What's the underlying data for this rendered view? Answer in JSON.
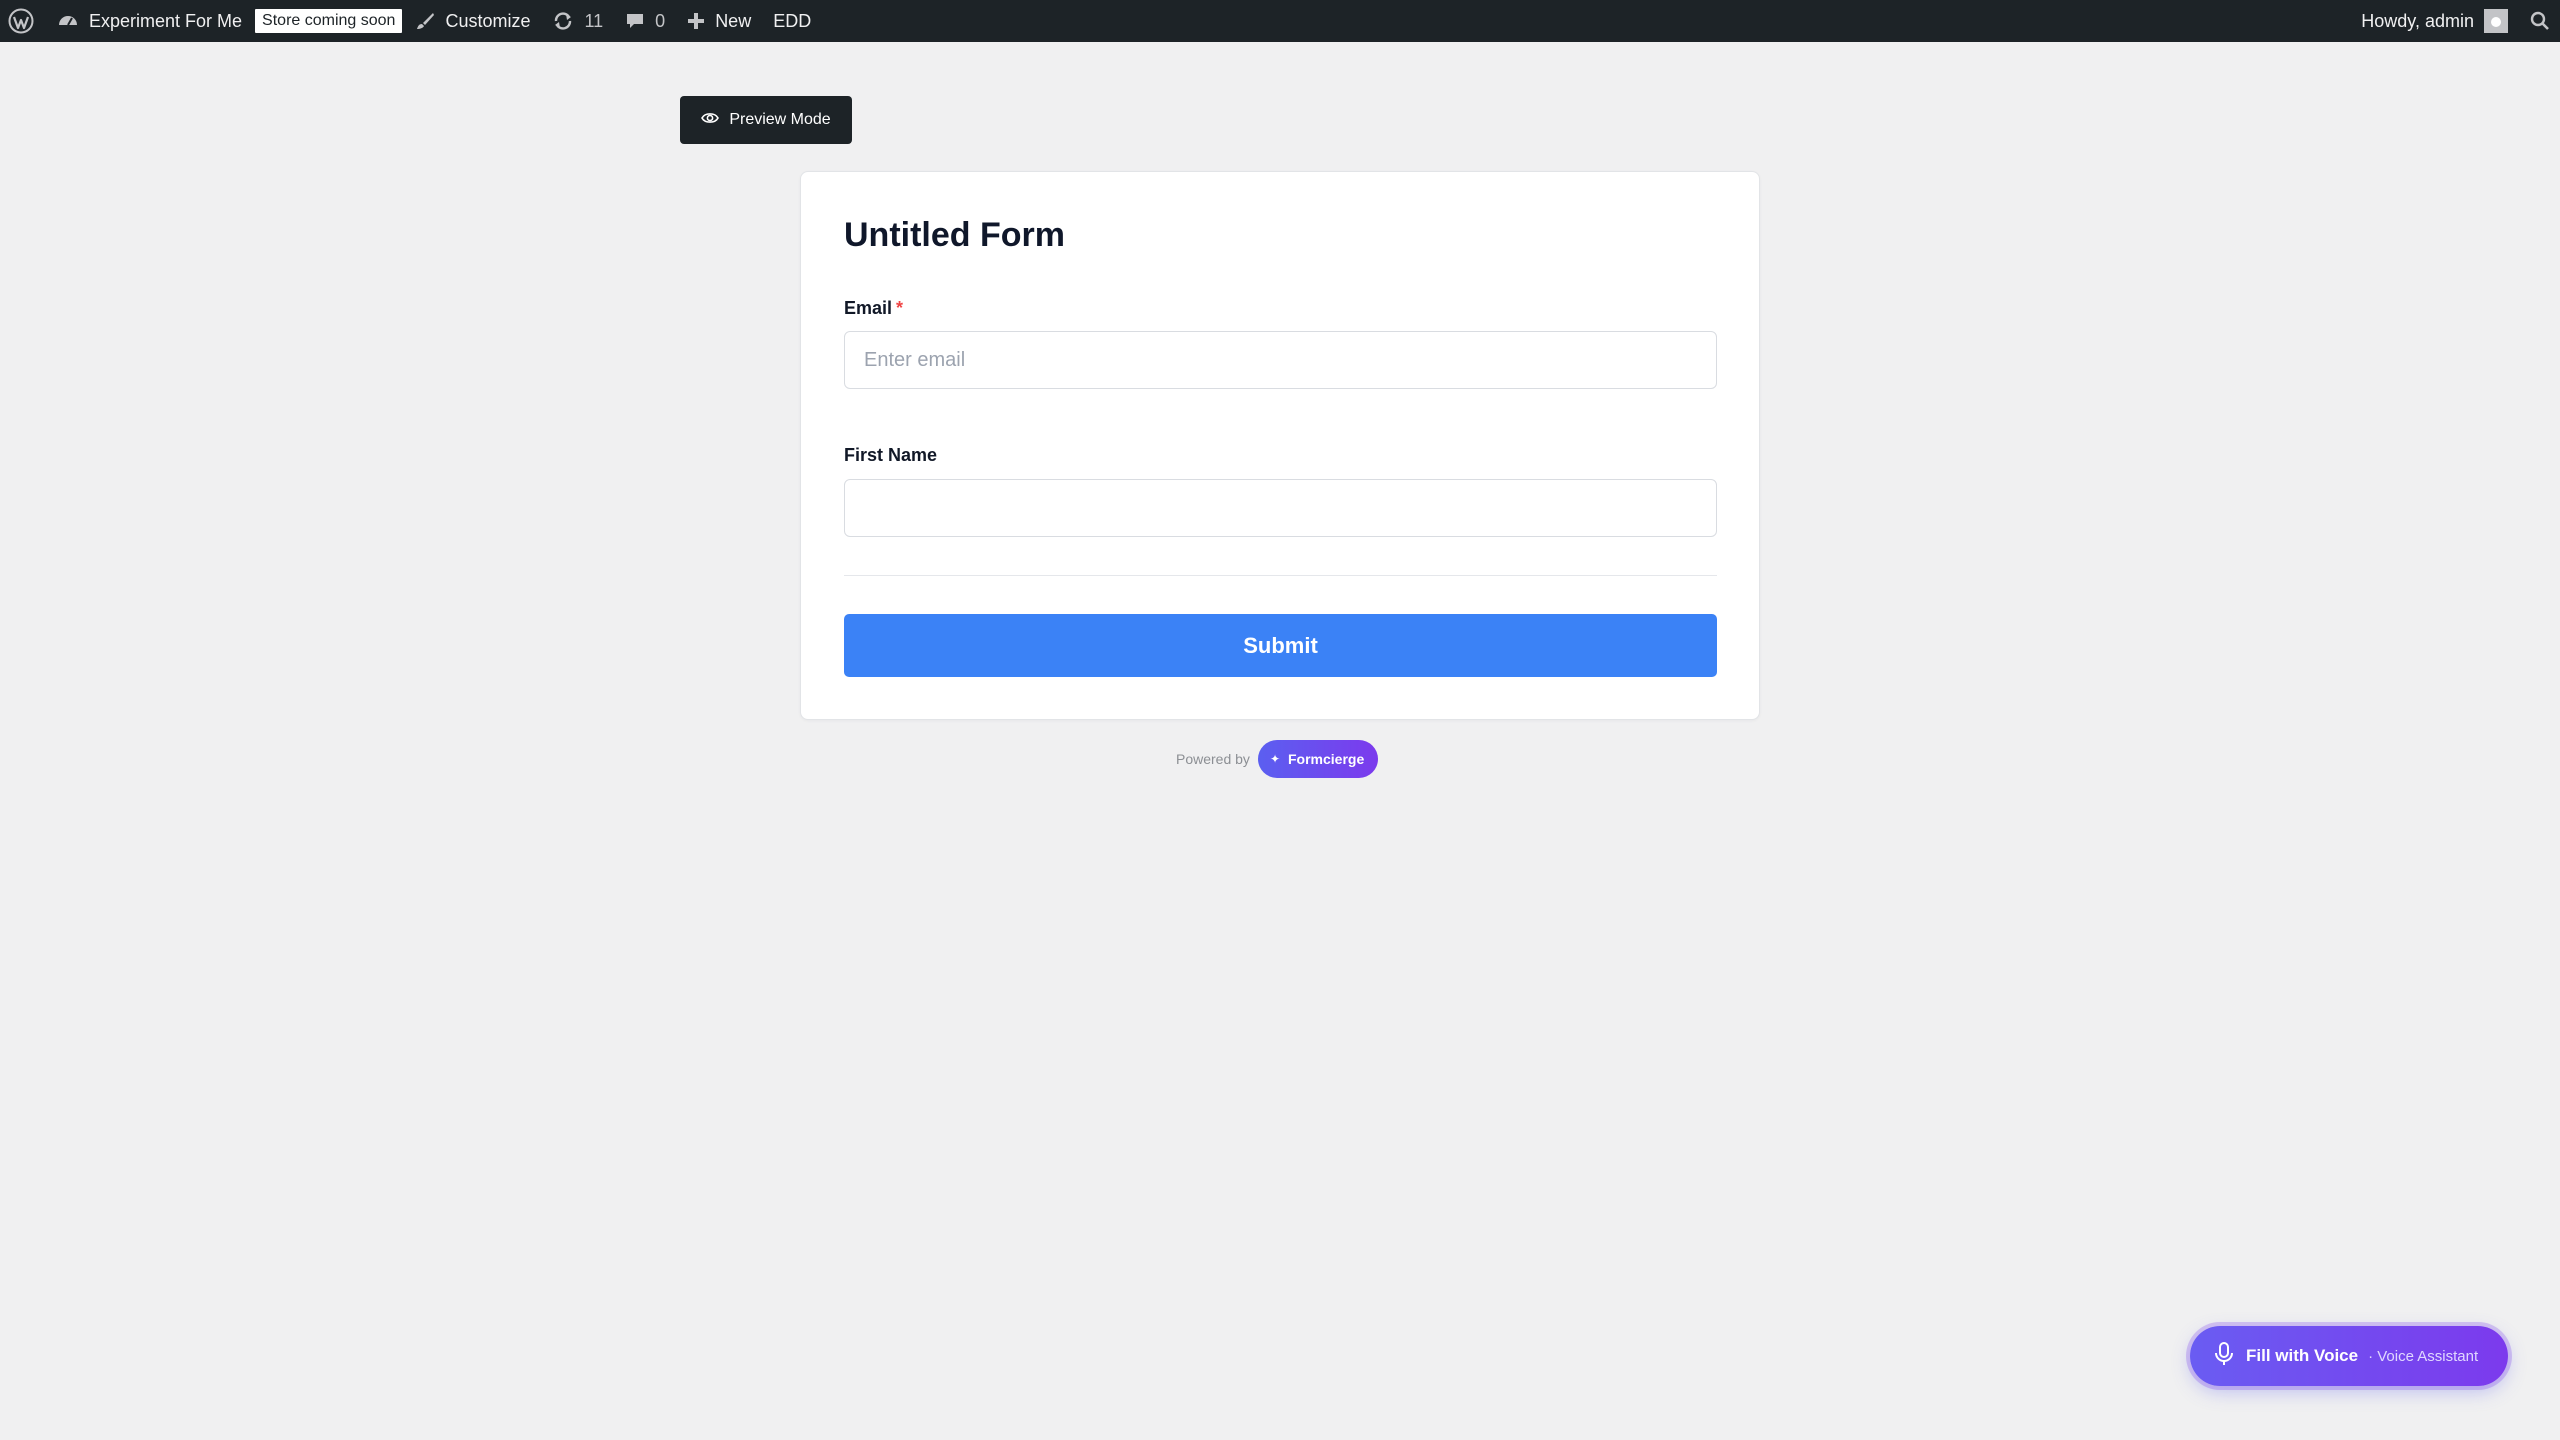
{
  "adminbar": {
    "site_name": "Experiment For Me",
    "store_badge": "Store coming soon",
    "customize": "Customize",
    "updates_count": "11",
    "comments_count": "0",
    "new_label": "New",
    "edd_label": "EDD",
    "howdy": "Howdy, admin",
    "icons": [
      "wordpress-icon",
      "dashboard-icon",
      "brush-icon",
      "updates-icon",
      "comment-icon",
      "plus-icon",
      "search-icon",
      "avatar"
    ]
  },
  "preview": {
    "label": "Preview Mode",
    "icon": "eye-icon"
  },
  "form": {
    "title": "Untitled Form",
    "fields": [
      {
        "label": "Email",
        "required": "*",
        "placeholder": "Enter email",
        "value": ""
      },
      {
        "label": "First Name",
        "required": "",
        "placeholder": "",
        "value": ""
      }
    ],
    "submit_label": "Submit",
    "submit_color": "#3b82f6"
  },
  "footer": {
    "powered_by": "Powered by",
    "brand": "Formcierge",
    "brand_icon": "sparkle"
  },
  "voice": {
    "main_label": "Fill with Voice",
    "sub_label": "· Voice Assistant",
    "icon": "microphone-icon"
  }
}
